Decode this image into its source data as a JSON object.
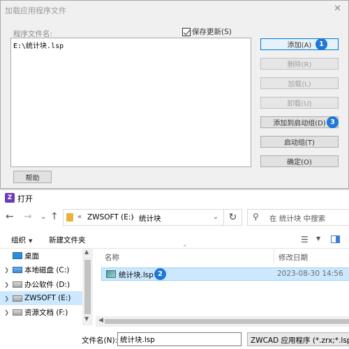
{
  "load_dialog": {
    "title": "加载应用程序文件",
    "file_label": "程序文件名:",
    "save_update_label": "保存更新(S)",
    "save_update_checked": true,
    "files": [
      "E:\\统计块.lsp"
    ],
    "buttons": {
      "add": "添加(A)",
      "delete": "删除(R)",
      "load": "加载(L)",
      "unload": "卸载(U)",
      "add_startup": "添加到启动组(D)",
      "startup": "启动组(T)",
      "ok": "确定(O)",
      "help": "帮助"
    },
    "steps": [
      "1",
      "2",
      "3"
    ]
  },
  "open_dialog": {
    "title": "打开",
    "app_icon_letter": "Z",
    "path": {
      "chevrons": "«",
      "drive": "ZWSOFT (E:)",
      "separator": "›",
      "folder": "统计块"
    },
    "search_placeholder": "在 统计块 中搜索",
    "toolbar": {
      "organize": "组织",
      "new_folder": "新建文件夹"
    },
    "nav_items": [
      {
        "label": "桌面",
        "icon": "desktop-icon"
      },
      {
        "label": "本地磁盘 (C:)",
        "icon": "drive-c-icon"
      },
      {
        "label": "办公软件 (D:)",
        "icon": "drive-icon"
      },
      {
        "label": "ZWSOFT (E:)",
        "icon": "drive-icon",
        "selected": true
      },
      {
        "label": "资源文档 (F:)",
        "icon": "drive-icon"
      }
    ],
    "columns": {
      "name": "名称",
      "date": "修改日期"
    },
    "file": {
      "name": "统计块.lsp",
      "date": "2023-08-30 14:56"
    },
    "filename_label": "文件名(N):",
    "filename_value": "统计块.lsp",
    "filetype_value": "ZWCAD 应用程序 (*.zrx;*.lsp;*.",
    "colors": {
      "accent": "#1e78d8",
      "selection": "#cce8ff"
    }
  }
}
